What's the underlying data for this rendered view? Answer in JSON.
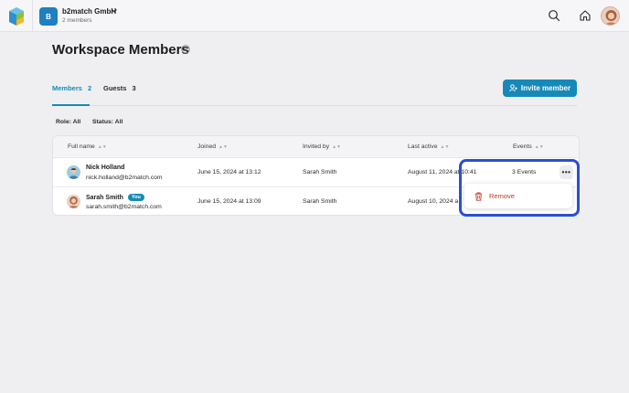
{
  "topbar": {
    "org_initial": "B",
    "org_name": "b2match GmbH",
    "org_members": "2 members",
    "icons": [
      "logo-icon",
      "chevron-down-icon",
      "search-icon",
      "home-icon",
      "user-avatar"
    ]
  },
  "page": {
    "title": "Workspace Members"
  },
  "tabs": [
    {
      "label": "Members",
      "count": "2",
      "active": true
    },
    {
      "label": "Guests",
      "count": "3",
      "active": false
    }
  ],
  "invite_button": {
    "label": "Invite member"
  },
  "filters": {
    "role": "Role: All",
    "status": "Status: All"
  },
  "table": {
    "columns": [
      "Full name",
      "Joined",
      "Invited by",
      "Last active",
      "Events"
    ],
    "rows": [
      {
        "name": "Nick Holland",
        "email": "nick.holland@b2match.com",
        "joined": "June 15, 2024 at 13:12",
        "invited_by": "Sarah Smith",
        "last_active": "August 11, 2024 at 10:41",
        "events": "3 Events",
        "badge": ""
      },
      {
        "name": "Sarah Smith",
        "email": "sarah.smith@b2match.com",
        "joined": "June 15, 2024 at 13:09",
        "invited_by": "Sarah Smith",
        "last_active": "August 10, 2024 a",
        "events": "",
        "badge": "You"
      }
    ]
  },
  "row_menu": {
    "more_label": "•••",
    "items": [
      {
        "label": "Remove",
        "color": "#c0392b"
      }
    ]
  },
  "colors": {
    "accent": "#1789b8",
    "highlight": "#2a4fd1",
    "danger": "#c0392b"
  }
}
